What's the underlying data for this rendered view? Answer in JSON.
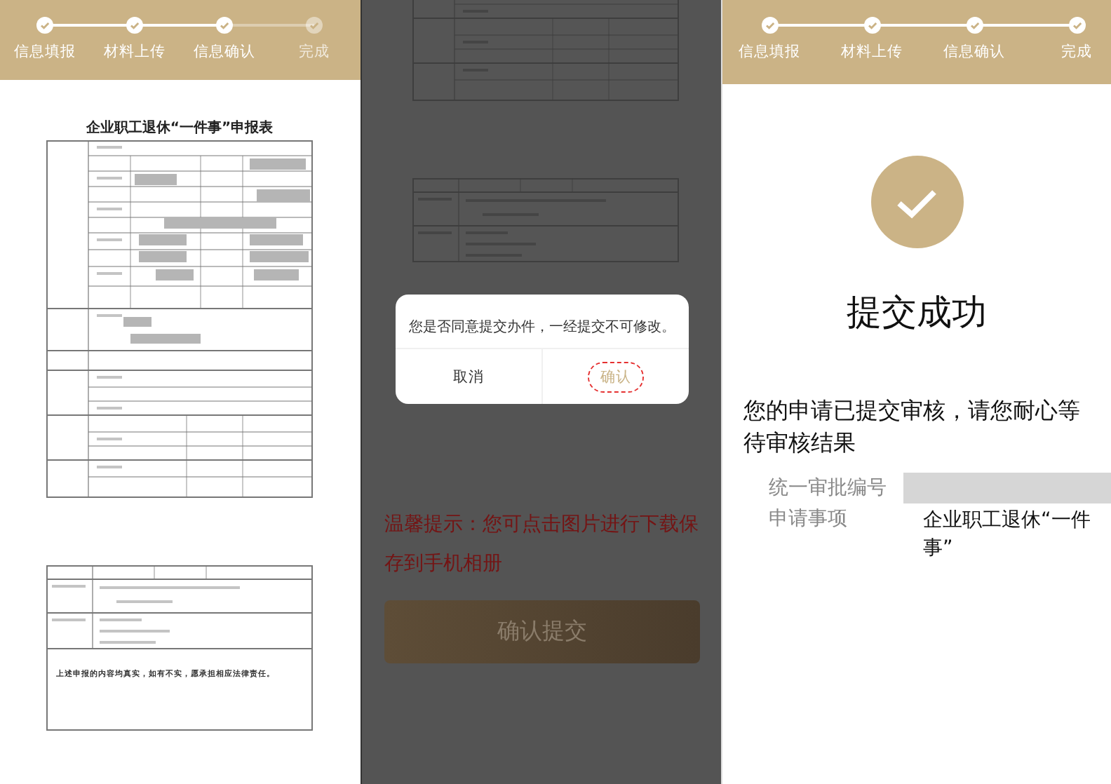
{
  "left_panel": {
    "steps": [
      {
        "label": "信息填报",
        "done": true
      },
      {
        "label": "材料上传",
        "done": true
      },
      {
        "label": "信息确认",
        "done": true
      },
      {
        "label": "完成",
        "done": false
      }
    ],
    "document": {
      "title": "企业职工退休“一件事”申报表",
      "declaration": "上述申报的内容均真实，如有不实，愿承担相应法律责任。"
    }
  },
  "middle_panel": {
    "dialog": {
      "message": "您是否同意提交办件，一经提交不可修改。",
      "buttons": [
        {
          "label": "取消",
          "focused": false
        },
        {
          "label": "确认",
          "focused": true
        }
      ]
    },
    "tip": "温馨提示：您可点击图片进行下载保存到手机相册",
    "submit_button": "确认提交"
  },
  "right_panel": {
    "steps": [
      {
        "label": "信息填报",
        "done": true
      },
      {
        "label": "材料上传",
        "done": true
      },
      {
        "label": "信息确认",
        "done": true
      },
      {
        "label": "完成",
        "done": true
      }
    ],
    "title": "提交成功",
    "message": "您的申请已提交审核，请您耐心等待审核结果",
    "fields": [
      {
        "label": "统一审批编号",
        "redacted": true
      },
      {
        "label": "申请事项",
        "redacted": false,
        "value": "企业职工退休“一件事”"
      }
    ]
  }
}
